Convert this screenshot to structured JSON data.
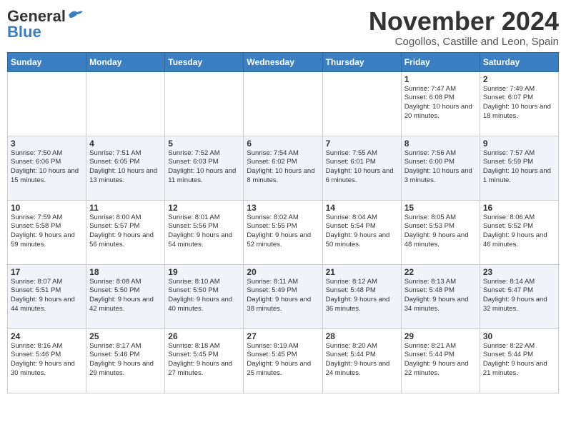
{
  "header": {
    "logo_general": "General",
    "logo_blue": "Blue",
    "month": "November 2024",
    "location": "Cogollos, Castille and Leon, Spain"
  },
  "weekdays": [
    "Sunday",
    "Monday",
    "Tuesday",
    "Wednesday",
    "Thursday",
    "Friday",
    "Saturday"
  ],
  "weeks": [
    [
      {
        "day": "",
        "info": ""
      },
      {
        "day": "",
        "info": ""
      },
      {
        "day": "",
        "info": ""
      },
      {
        "day": "",
        "info": ""
      },
      {
        "day": "",
        "info": ""
      },
      {
        "day": "1",
        "info": "Sunrise: 7:47 AM\nSunset: 6:08 PM\nDaylight: 10 hours and 20 minutes."
      },
      {
        "day": "2",
        "info": "Sunrise: 7:49 AM\nSunset: 6:07 PM\nDaylight: 10 hours and 18 minutes."
      }
    ],
    [
      {
        "day": "3",
        "info": "Sunrise: 7:50 AM\nSunset: 6:06 PM\nDaylight: 10 hours and 15 minutes."
      },
      {
        "day": "4",
        "info": "Sunrise: 7:51 AM\nSunset: 6:05 PM\nDaylight: 10 hours and 13 minutes."
      },
      {
        "day": "5",
        "info": "Sunrise: 7:52 AM\nSunset: 6:03 PM\nDaylight: 10 hours and 11 minutes."
      },
      {
        "day": "6",
        "info": "Sunrise: 7:54 AM\nSunset: 6:02 PM\nDaylight: 10 hours and 8 minutes."
      },
      {
        "day": "7",
        "info": "Sunrise: 7:55 AM\nSunset: 6:01 PM\nDaylight: 10 hours and 6 minutes."
      },
      {
        "day": "8",
        "info": "Sunrise: 7:56 AM\nSunset: 6:00 PM\nDaylight: 10 hours and 3 minutes."
      },
      {
        "day": "9",
        "info": "Sunrise: 7:57 AM\nSunset: 5:59 PM\nDaylight: 10 hours and 1 minute."
      }
    ],
    [
      {
        "day": "10",
        "info": "Sunrise: 7:59 AM\nSunset: 5:58 PM\nDaylight: 9 hours and 59 minutes."
      },
      {
        "day": "11",
        "info": "Sunrise: 8:00 AM\nSunset: 5:57 PM\nDaylight: 9 hours and 56 minutes."
      },
      {
        "day": "12",
        "info": "Sunrise: 8:01 AM\nSunset: 5:56 PM\nDaylight: 9 hours and 54 minutes."
      },
      {
        "day": "13",
        "info": "Sunrise: 8:02 AM\nSunset: 5:55 PM\nDaylight: 9 hours and 52 minutes."
      },
      {
        "day": "14",
        "info": "Sunrise: 8:04 AM\nSunset: 5:54 PM\nDaylight: 9 hours and 50 minutes."
      },
      {
        "day": "15",
        "info": "Sunrise: 8:05 AM\nSunset: 5:53 PM\nDaylight: 9 hours and 48 minutes."
      },
      {
        "day": "16",
        "info": "Sunrise: 8:06 AM\nSunset: 5:52 PM\nDaylight: 9 hours and 46 minutes."
      }
    ],
    [
      {
        "day": "17",
        "info": "Sunrise: 8:07 AM\nSunset: 5:51 PM\nDaylight: 9 hours and 44 minutes."
      },
      {
        "day": "18",
        "info": "Sunrise: 8:08 AM\nSunset: 5:50 PM\nDaylight: 9 hours and 42 minutes."
      },
      {
        "day": "19",
        "info": "Sunrise: 8:10 AM\nSunset: 5:50 PM\nDaylight: 9 hours and 40 minutes."
      },
      {
        "day": "20",
        "info": "Sunrise: 8:11 AM\nSunset: 5:49 PM\nDaylight: 9 hours and 38 minutes."
      },
      {
        "day": "21",
        "info": "Sunrise: 8:12 AM\nSunset: 5:48 PM\nDaylight: 9 hours and 36 minutes."
      },
      {
        "day": "22",
        "info": "Sunrise: 8:13 AM\nSunset: 5:48 PM\nDaylight: 9 hours and 34 minutes."
      },
      {
        "day": "23",
        "info": "Sunrise: 8:14 AM\nSunset: 5:47 PM\nDaylight: 9 hours and 32 minutes."
      }
    ],
    [
      {
        "day": "24",
        "info": "Sunrise: 8:16 AM\nSunset: 5:46 PM\nDaylight: 9 hours and 30 minutes."
      },
      {
        "day": "25",
        "info": "Sunrise: 8:17 AM\nSunset: 5:46 PM\nDaylight: 9 hours and 29 minutes."
      },
      {
        "day": "26",
        "info": "Sunrise: 8:18 AM\nSunset: 5:45 PM\nDaylight: 9 hours and 27 minutes."
      },
      {
        "day": "27",
        "info": "Sunrise: 8:19 AM\nSunset: 5:45 PM\nDaylight: 9 hours and 25 minutes."
      },
      {
        "day": "28",
        "info": "Sunrise: 8:20 AM\nSunset: 5:44 PM\nDaylight: 9 hours and 24 minutes."
      },
      {
        "day": "29",
        "info": "Sunrise: 8:21 AM\nSunset: 5:44 PM\nDaylight: 9 hours and 22 minutes."
      },
      {
        "day": "30",
        "info": "Sunrise: 8:22 AM\nSunset: 5:44 PM\nDaylight: 9 hours and 21 minutes."
      }
    ]
  ]
}
